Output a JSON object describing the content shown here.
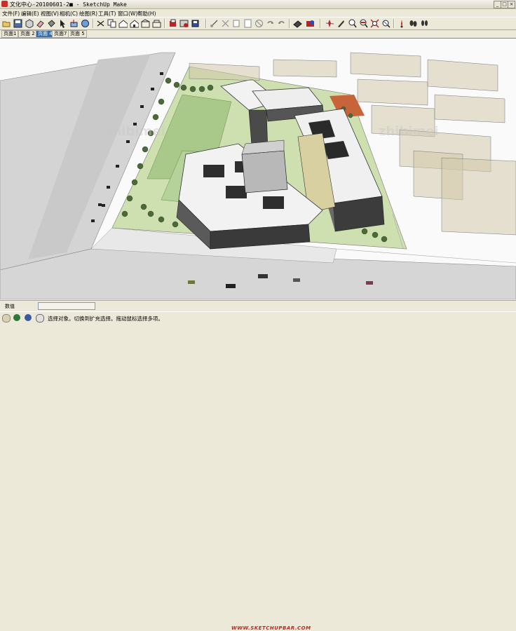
{
  "window": {
    "title": "文化中心-20100601-2■ - SketchUp Make",
    "controls": [
      "_",
      "□",
      "×"
    ]
  },
  "menu": {
    "items": [
      "文件(F)",
      "编辑(E)",
      "视图(V)",
      "相机(C)",
      "绘图(R)",
      "工具(T)",
      "窗口(W)",
      "帮助(H)"
    ]
  },
  "toolbar": {
    "icons": [
      "open-icon",
      "save-icon",
      "make-component-icon",
      "eraser-icon",
      "paint-bucket-icon",
      "select-icon",
      "push-pull-icon",
      "rotate-icon",
      "cut-icon",
      "copy-icon",
      "paste-icon",
      "erase-icon",
      "undo-icon",
      "redo-icon",
      "print-icon",
      "model-info-icon",
      "iso-view-icon",
      "top-view-icon",
      "front-view-icon",
      "right-view-icon",
      "back-view-icon",
      "left-view-icon",
      "orbit-icon",
      "pan-icon",
      "zoom-icon",
      "zoom-window-icon",
      "zoom-extents-icon",
      "previous-view-icon",
      "position-camera-icon",
      "walk-icon",
      "look-around-icon"
    ]
  },
  "scene_tabs": {
    "items": [
      "页面1",
      "页面 2",
      "页面 4",
      "页面7",
      "页面 5"
    ],
    "active_index": 2
  },
  "viewport": {
    "watermark_text": "zhibimei"
  },
  "status": {
    "measurements_label": "数值",
    "measurements_value": "",
    "hint": "选择对象。切换到扩充选择。拖动鼠标选择多项。",
    "watermark": "WWW.SKETCHUPBAR.COM"
  }
}
